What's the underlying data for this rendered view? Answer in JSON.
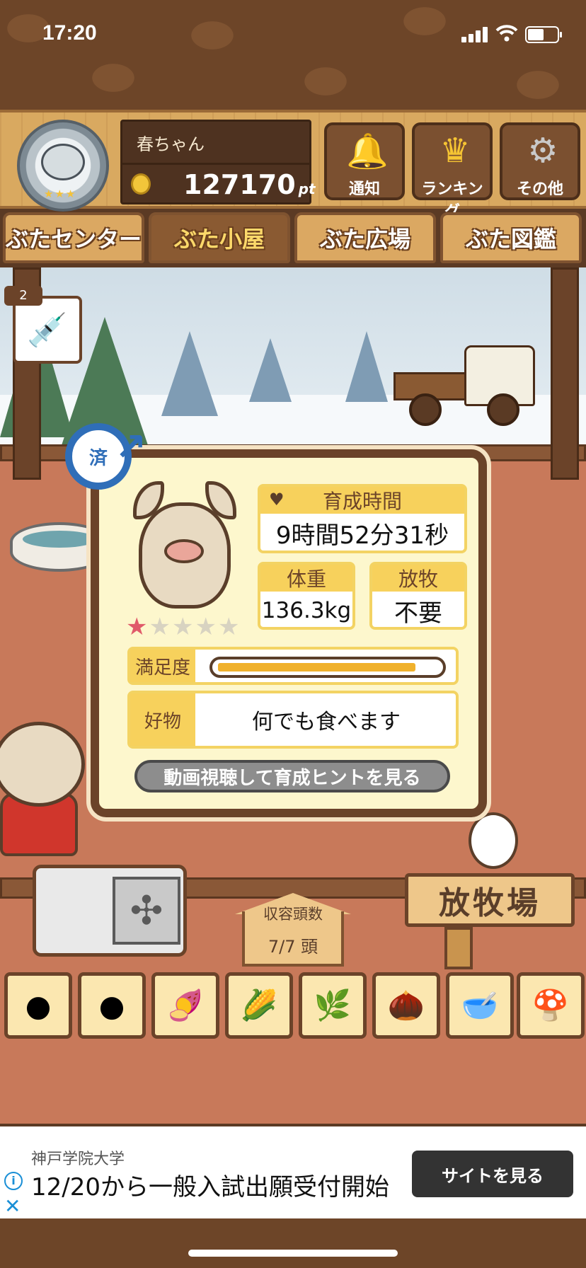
{
  "status": {
    "time": "17:20"
  },
  "profile": {
    "name": "春ちゃん",
    "points": "127170",
    "points_unit": "pt"
  },
  "header_buttons": [
    {
      "label": "通知",
      "icon": "bell-icon"
    },
    {
      "label": "ランキング",
      "icon": "crown-icon"
    },
    {
      "label": "その他",
      "icon": "gear-icon"
    }
  ],
  "tabs": [
    {
      "label": "ぶたセンター",
      "active": false
    },
    {
      "label": "ぶた小屋",
      "active": true
    },
    {
      "label": "ぶた広場",
      "active": false
    },
    {
      "label": "ぶた図鑑",
      "active": false
    }
  ],
  "syringe": {
    "count": "2"
  },
  "pig_card": {
    "badge": "済",
    "rating_on": 1,
    "rating_max": 5,
    "raise_time": {
      "label": "育成時間",
      "value": "9時間52分31秒"
    },
    "weight": {
      "label": "体重",
      "value": "136.3kg"
    },
    "grazing": {
      "label": "放牧",
      "value": "不要"
    },
    "satisfaction": {
      "label": "満足度",
      "level": 0.9
    },
    "favorite": {
      "label": "好物",
      "value": "何でも食べます"
    },
    "hint_button": "動画視聴して育成ヒントを見る"
  },
  "capacity": {
    "label": "収容頭数",
    "value": "7/7 頭"
  },
  "pasture_sign": "放牧場",
  "food_items": [
    "grain-icon",
    "mixed-grain-icon",
    "sweet-potato-icon",
    "corn-icon",
    "soybean-icon",
    "acorn-icon",
    "feed-bowl-icon",
    "truffle-icon"
  ],
  "ad": {
    "advertiser": "神戸学院大学",
    "headline": "12/20から一般入試出願受付開始",
    "cta": "サイトを見る"
  },
  "colors": {
    "wood": "#d9a960",
    "dark_wood": "#6b4329",
    "accent_yellow": "#f7d15c",
    "male_blue": "#2f6eb8",
    "ad_button": "#333333"
  }
}
